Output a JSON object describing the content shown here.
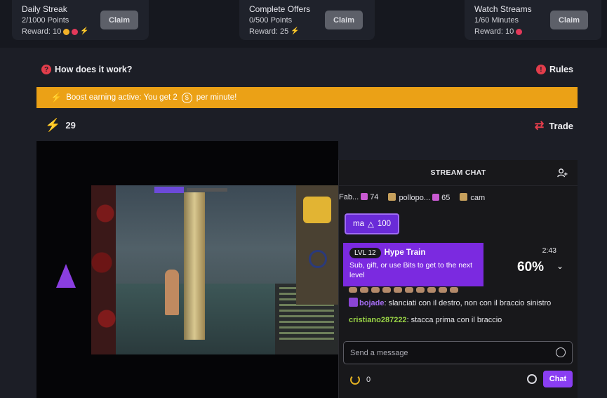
{
  "tasks": [
    {
      "title": "Daily Streak",
      "progress": "2/1000 Points",
      "reward_label": "Reward: 10",
      "claim": "Claim"
    },
    {
      "title": "Complete Offers",
      "progress": "0/500 Points",
      "reward_label": "Reward: 25",
      "claim": "Claim"
    },
    {
      "title": "Watch Streams",
      "progress": "1/60 Minutes",
      "reward_label": "Reward: 10",
      "claim": "Claim"
    }
  ],
  "how": {
    "label": "How does it work?",
    "icon": "question-icon"
  },
  "rules": {
    "label": "Rules",
    "icon": "exclamation-icon"
  },
  "boost": {
    "before": "Boost earning active: You get 2",
    "after": "per minute!",
    "coin_symbol": "$"
  },
  "energy": {
    "value": "29",
    "icon": "lightning-icon"
  },
  "trade": {
    "label": "Trade",
    "icon": "swap-arrows-icon"
  },
  "chat": {
    "header": "STREAM CHAT",
    "subs": [
      {
        "name": "Fab...",
        "count": "74"
      },
      {
        "name": "pollopo...",
        "count": "65"
      },
      {
        "name": "cam",
        "count": ""
      }
    ],
    "badge": {
      "name": "ma",
      "value": "100"
    },
    "hype": {
      "level": "LVL 12",
      "title": "Hype Train",
      "desc": "Sub, gift, or use Bits to get to the next level",
      "time": "2:43",
      "percent": "60%",
      "progress_fraction": 0.6
    },
    "messages": [
      {
        "user": "bojade",
        "text": ": slanciati con il destro, non con il braccio sinistro"
      },
      {
        "user": "cristiano287222",
        "text": ": stacca prima con il braccio"
      }
    ],
    "input_placeholder": "Send a message",
    "points": "0",
    "chat_button": "Chat"
  },
  "colors": {
    "accent_orange": "#eba116",
    "accent_purple": "#8a3ef2",
    "alert_red": "#e23d4b"
  }
}
